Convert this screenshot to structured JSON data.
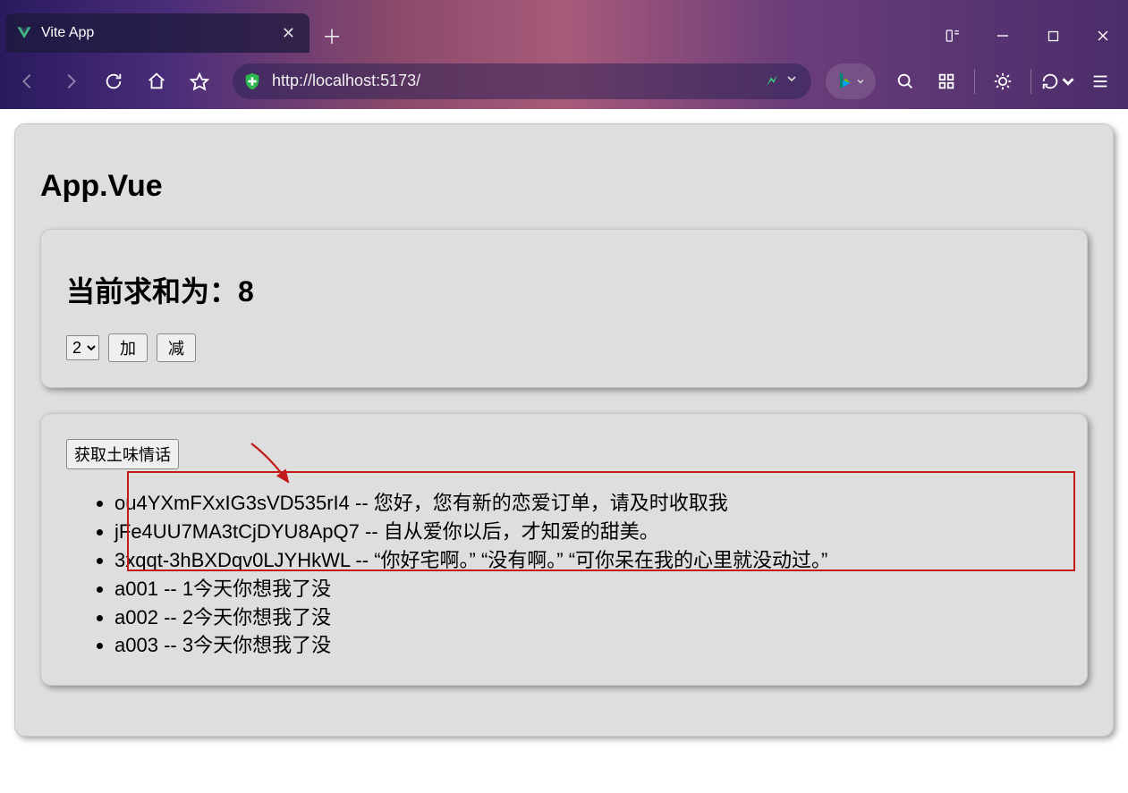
{
  "browser": {
    "tab_title": "Vite App",
    "url": "http://localhost:5173/"
  },
  "page": {
    "title": "App.Vue"
  },
  "counter": {
    "label_prefix": "当前求和为：",
    "value": "8",
    "select_value": "2",
    "add_label": "加",
    "sub_label": "减"
  },
  "talk": {
    "fetch_label": "获取土味情话",
    "items": [
      {
        "id": "ou4YXmFXxIG3sVD535rI4",
        "sep": " -- ",
        "text": "您好，您有新的恋爱订单，请及时收取我"
      },
      {
        "id": "jFe4UU7MA3tCjDYU8ApQ7",
        "sep": " -- ",
        "text": "自从爱你以后，才知爱的甜美。"
      },
      {
        "id": "3xqqt-3hBXDqv0LJYHkWL",
        "sep": " -- ",
        "text": "“你好宅啊。” “没有啊。” “可你呆在我的心里就没动过。”"
      },
      {
        "id": "a001",
        "sep": " -- ",
        "text": "1今天你想我了没"
      },
      {
        "id": "a002",
        "sep": " -- ",
        "text": "2今天你想我了没"
      },
      {
        "id": "a003",
        "sep": " -- ",
        "text": "3今天你想我了没"
      }
    ]
  }
}
